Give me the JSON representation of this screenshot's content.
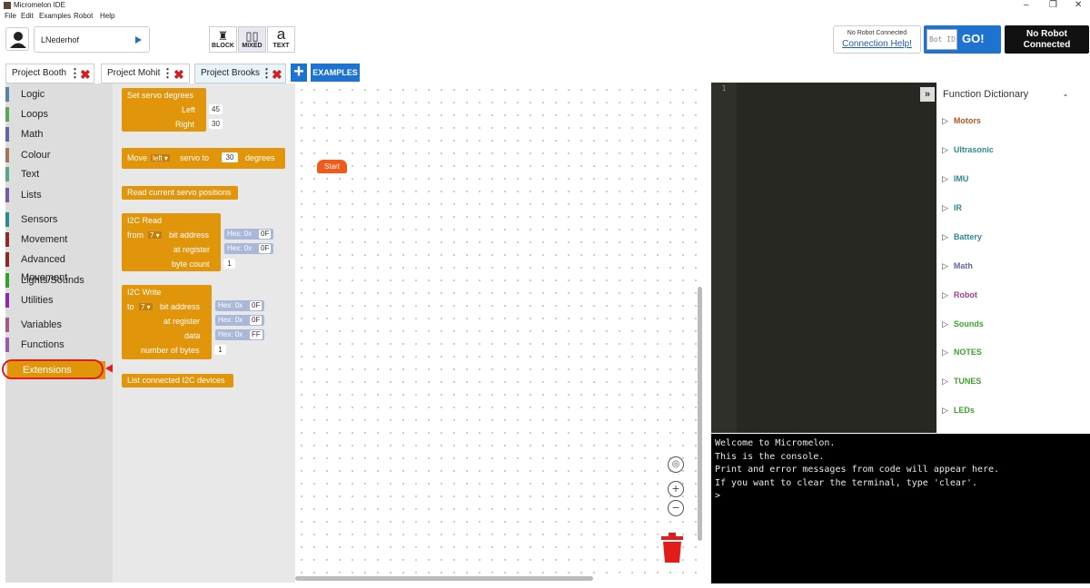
{
  "window": {
    "title": "Micromelon IDE"
  },
  "menu": [
    "File",
    "Edit",
    "Examples",
    "Robot",
    "Help"
  ],
  "user": {
    "name": "LNederhof"
  },
  "modes": [
    {
      "label": "BLOCK",
      "icon": "puzzle-icon",
      "glyph": "♜"
    },
    {
      "label": "MIXED",
      "icon": "split-view-icon",
      "glyph": "▯▯"
    },
    {
      "label": "TEXT",
      "icon": "text-a-icon",
      "glyph": "a"
    }
  ],
  "connection": {
    "status": "No Robot Connected",
    "help_link": "Connection Help!"
  },
  "bot": {
    "id_placeholder": "Bot ID",
    "go_label": "GO!",
    "status_line1": "No Robot",
    "status_line2": "Connected"
  },
  "tabs": [
    {
      "label": "Project Booth"
    },
    {
      "label": "Project Mohit"
    },
    {
      "label": "Project Brooks"
    }
  ],
  "examples_label": "EXAMPLES",
  "categories": [
    {
      "label": "Logic",
      "color": "#5b80a5"
    },
    {
      "label": "Loops",
      "color": "#5ba55b"
    },
    {
      "label": "Math",
      "color": "#5b67a5"
    },
    {
      "label": "Colour",
      "color": "#a5745b"
    },
    {
      "label": "Text",
      "color": "#5ba58c"
    },
    {
      "label": "Lists",
      "color": "#745ba5"
    },
    {
      "label": "Sensors",
      "color": "#2a8c8c"
    },
    {
      "label": "Movement",
      "color": "#8c2a2a"
    },
    {
      "label": "Advanced Movement",
      "color": "#8c2a2a"
    },
    {
      "label": "Lights/Sounds",
      "color": "#2aa52a"
    },
    {
      "label": "Utilities",
      "color": "#8c2aa5"
    },
    {
      "label": "Variables",
      "color": "#a55b80"
    },
    {
      "label": "Functions",
      "color": "#995ba5"
    },
    {
      "label": "Extensions",
      "color": "#e0950b"
    }
  ],
  "blocks": {
    "set_servo": {
      "title": "Set servo degrees",
      "left_label": "Left",
      "left_value": "45",
      "right_label": "Right",
      "right_value": "30"
    },
    "move_servo": {
      "prefix": "Move",
      "side": "left",
      "middle": "servo to",
      "value": "30",
      "suffix": "degrees"
    },
    "read_servo": {
      "title": "Read current servo positions"
    },
    "i2c_read": {
      "title": "I2C Read",
      "from_label": "from",
      "bits": "7",
      "bit_address_label": "bit address",
      "hex_prefix": "Hex: 0x",
      "address": "0F",
      "register_label": "at register",
      "register": "0F",
      "byte_count_label": "byte count",
      "byte_count": "1"
    },
    "i2c_write": {
      "title": "I2C Write",
      "to_label": "to",
      "bits": "7",
      "bit_address_label": "bit address",
      "hex_prefix": "Hex: 0x",
      "address": "0F",
      "register_label": "at register",
      "register": "0F",
      "data_label": "data",
      "data": "FF",
      "bytes_label": "number of bytes",
      "bytes": "1"
    },
    "list_i2c": {
      "title": "List connected I2C devices"
    },
    "start": {
      "label": "Start"
    }
  },
  "editor": {
    "line_number": "1"
  },
  "dictionary": {
    "title": "Function Dictionary",
    "items": [
      {
        "label": "Motors",
        "color": "#b5551d"
      },
      {
        "label": "Ultrasonic",
        "color": "#2a8c8c"
      },
      {
        "label": "IMU",
        "color": "#2a8c8c"
      },
      {
        "label": "IR",
        "color": "#2a8c8c"
      },
      {
        "label": "Battery",
        "color": "#2a8c8c"
      },
      {
        "label": "Math",
        "color": "#5b67a5"
      },
      {
        "label": "Robot",
        "color": "#a53a8c"
      },
      {
        "label": "Sounds",
        "color": "#3aa52a"
      },
      {
        "label": "NOTES",
        "color": "#3aa52a"
      },
      {
        "label": "TUNES",
        "color": "#3aa52a"
      },
      {
        "label": "LEDs",
        "color": "#3aa52a"
      }
    ]
  },
  "console": {
    "lines": [
      "Welcome to Micromelon.",
      "This is the console.",
      "Print and error messages from code will appear here.",
      "If you want to clear the terminal, type 'clear'.",
      ">"
    ]
  },
  "colors": {
    "block": "#e0950b",
    "accent": "#1e73d1",
    "highlight": "#e21b1b",
    "start": "#f05a1a"
  }
}
